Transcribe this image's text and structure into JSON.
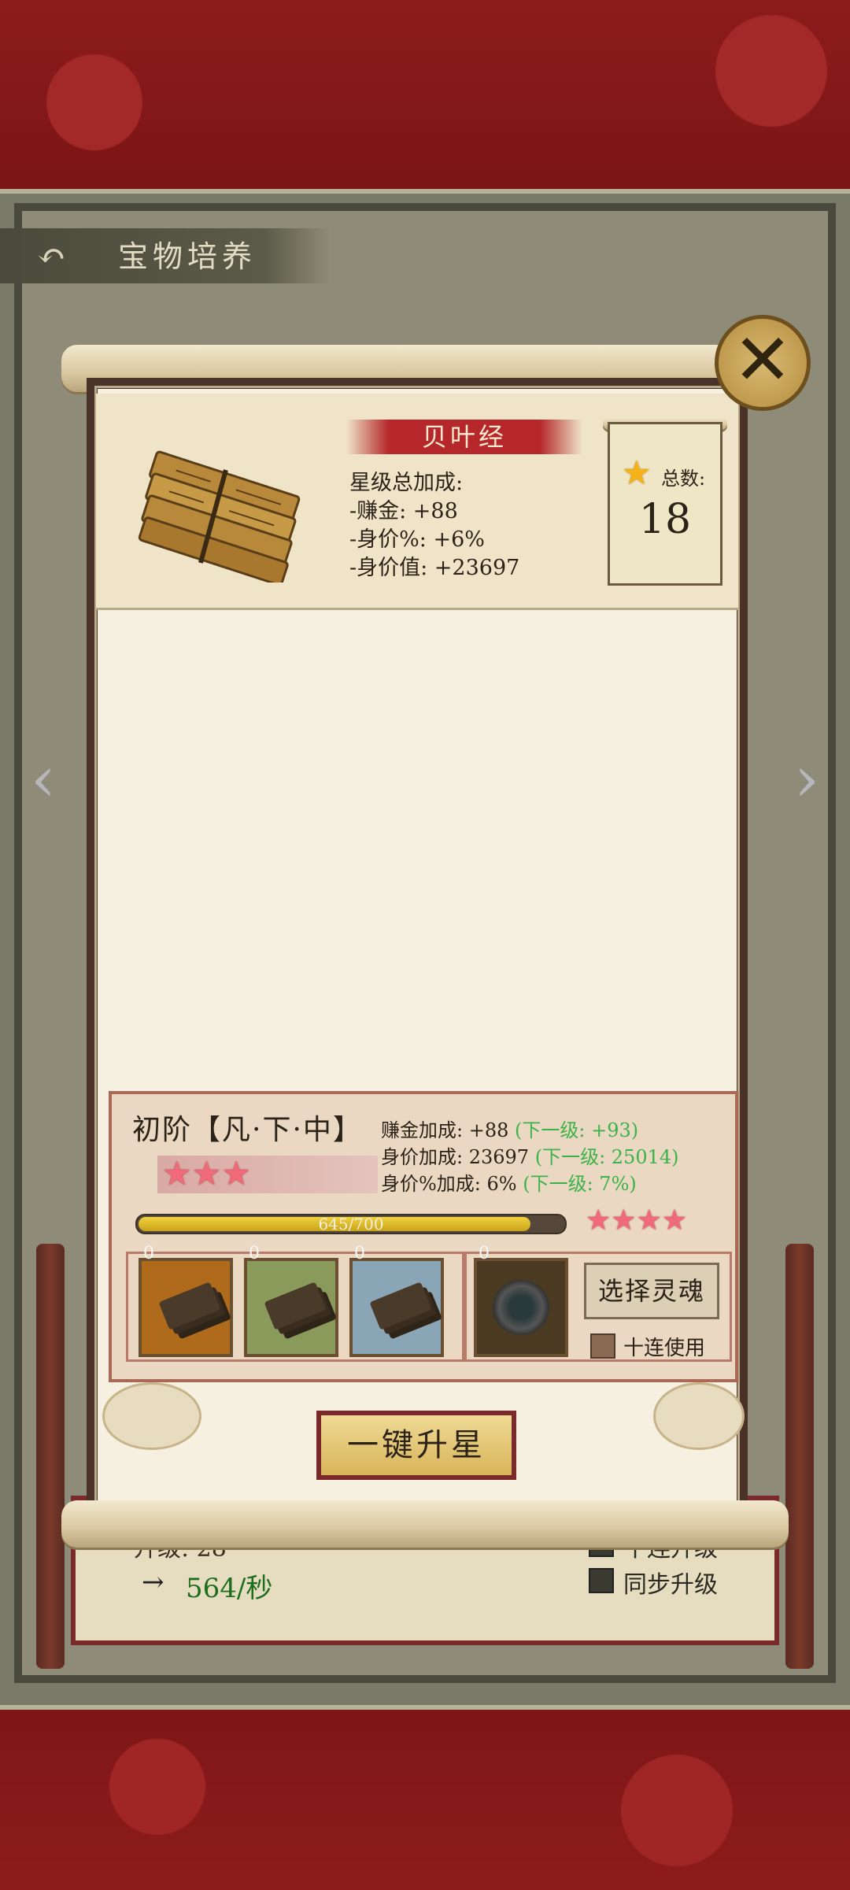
{
  "header": {
    "title": "宝物培养"
  },
  "item": {
    "name": "贝叶经",
    "bonus_title": "星级总加成:",
    "bonus_lines": [
      "-赚金: +88",
      "-身价%: +6%",
      "-身价值: +23697"
    ],
    "total_label": "总数:",
    "total_value": "18"
  },
  "upgrade": {
    "rank": "初阶【凡·下·中】",
    "current_stars": 3,
    "next_stars": 4,
    "stats": [
      {
        "label": "赚金加成: +88",
        "next": "(下一级: +93)"
      },
      {
        "label": "身价加成: 23697",
        "next": "(下一级: 25014)"
      },
      {
        "label": "身价%加成: 6%",
        "next": "(下一级: 7%)"
      }
    ],
    "progress_text": "645/700",
    "progress_value": 645,
    "progress_max": 700,
    "materials": [
      {
        "count": "0",
        "bg": "#b06a1c"
      },
      {
        "count": "0",
        "bg": "#8a9a5a"
      },
      {
        "count": "0",
        "bg": "#8aa6b6"
      }
    ],
    "soul_slot_count": "0",
    "soul_button": "选择灵魂",
    "ten_use_label": "十连使用",
    "one_key_button": "一键升星"
  },
  "background": {
    "speed_prefix": "→",
    "speed_value": "564/秒",
    "level_partial": "升级: 28",
    "ten_upgrade_label": "十连升级",
    "sync_upgrade_label": "同步升级"
  },
  "colors": {
    "accent_red": "#b5272a",
    "next_level_green": "#3db24a",
    "pink_star": "#f06a7a",
    "gold_star": "#f5b318"
  },
  "icons": {
    "back": "back-arrow-icon",
    "close": "close-icon",
    "star": "star-icon"
  }
}
